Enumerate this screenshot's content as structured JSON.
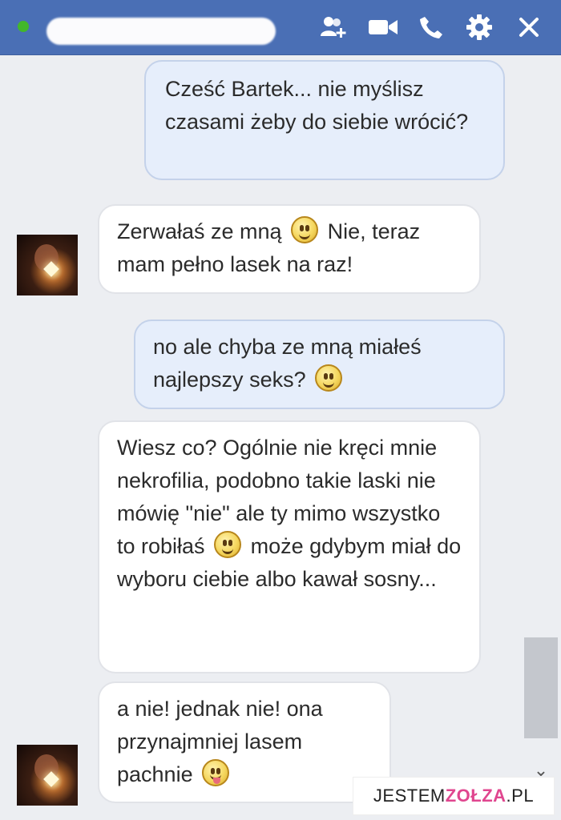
{
  "header": {
    "status": "online",
    "icons": [
      "add-friend-icon",
      "video-call-icon",
      "phone-icon",
      "gear-icon",
      "close-icon"
    ],
    "colors": {
      "bar": "#4a6fb5",
      "status": "#42b72a"
    }
  },
  "messages": [
    {
      "sender": "me",
      "text": "Cześć Bartek... nie myślisz czasami żeby do siebie wrócić?"
    },
    {
      "sender": "them",
      "before": "Zerwałaś ze mną",
      "emoji": "smile-emoji",
      "after": "Nie, teraz mam pełno lasek na raz!"
    },
    {
      "sender": "me",
      "before": "no ale chyba ze mną miałeś najlepszy seks?",
      "emoji": "smile-emoji"
    },
    {
      "sender": "them",
      "before": "Wiesz co? Ogólnie nie kręci mnie nekrofilia, podobno takie laski nie mówię \"nie\" ale ty mimo wszystko to robiłaś",
      "emoji": "smile-emoji",
      "after": "może gdybym miał do wyboru ciebie albo kawał sosny..."
    },
    {
      "sender": "them",
      "before": "a nie! jednak nie! ona przynajmniej lasem pachnie",
      "emoji": "tongue-emoji"
    }
  ],
  "watermark": {
    "part1": "JESTEM",
    "part2": "ZOŁZA",
    "part3": ".PL"
  },
  "scroll_arrow": "⌄"
}
